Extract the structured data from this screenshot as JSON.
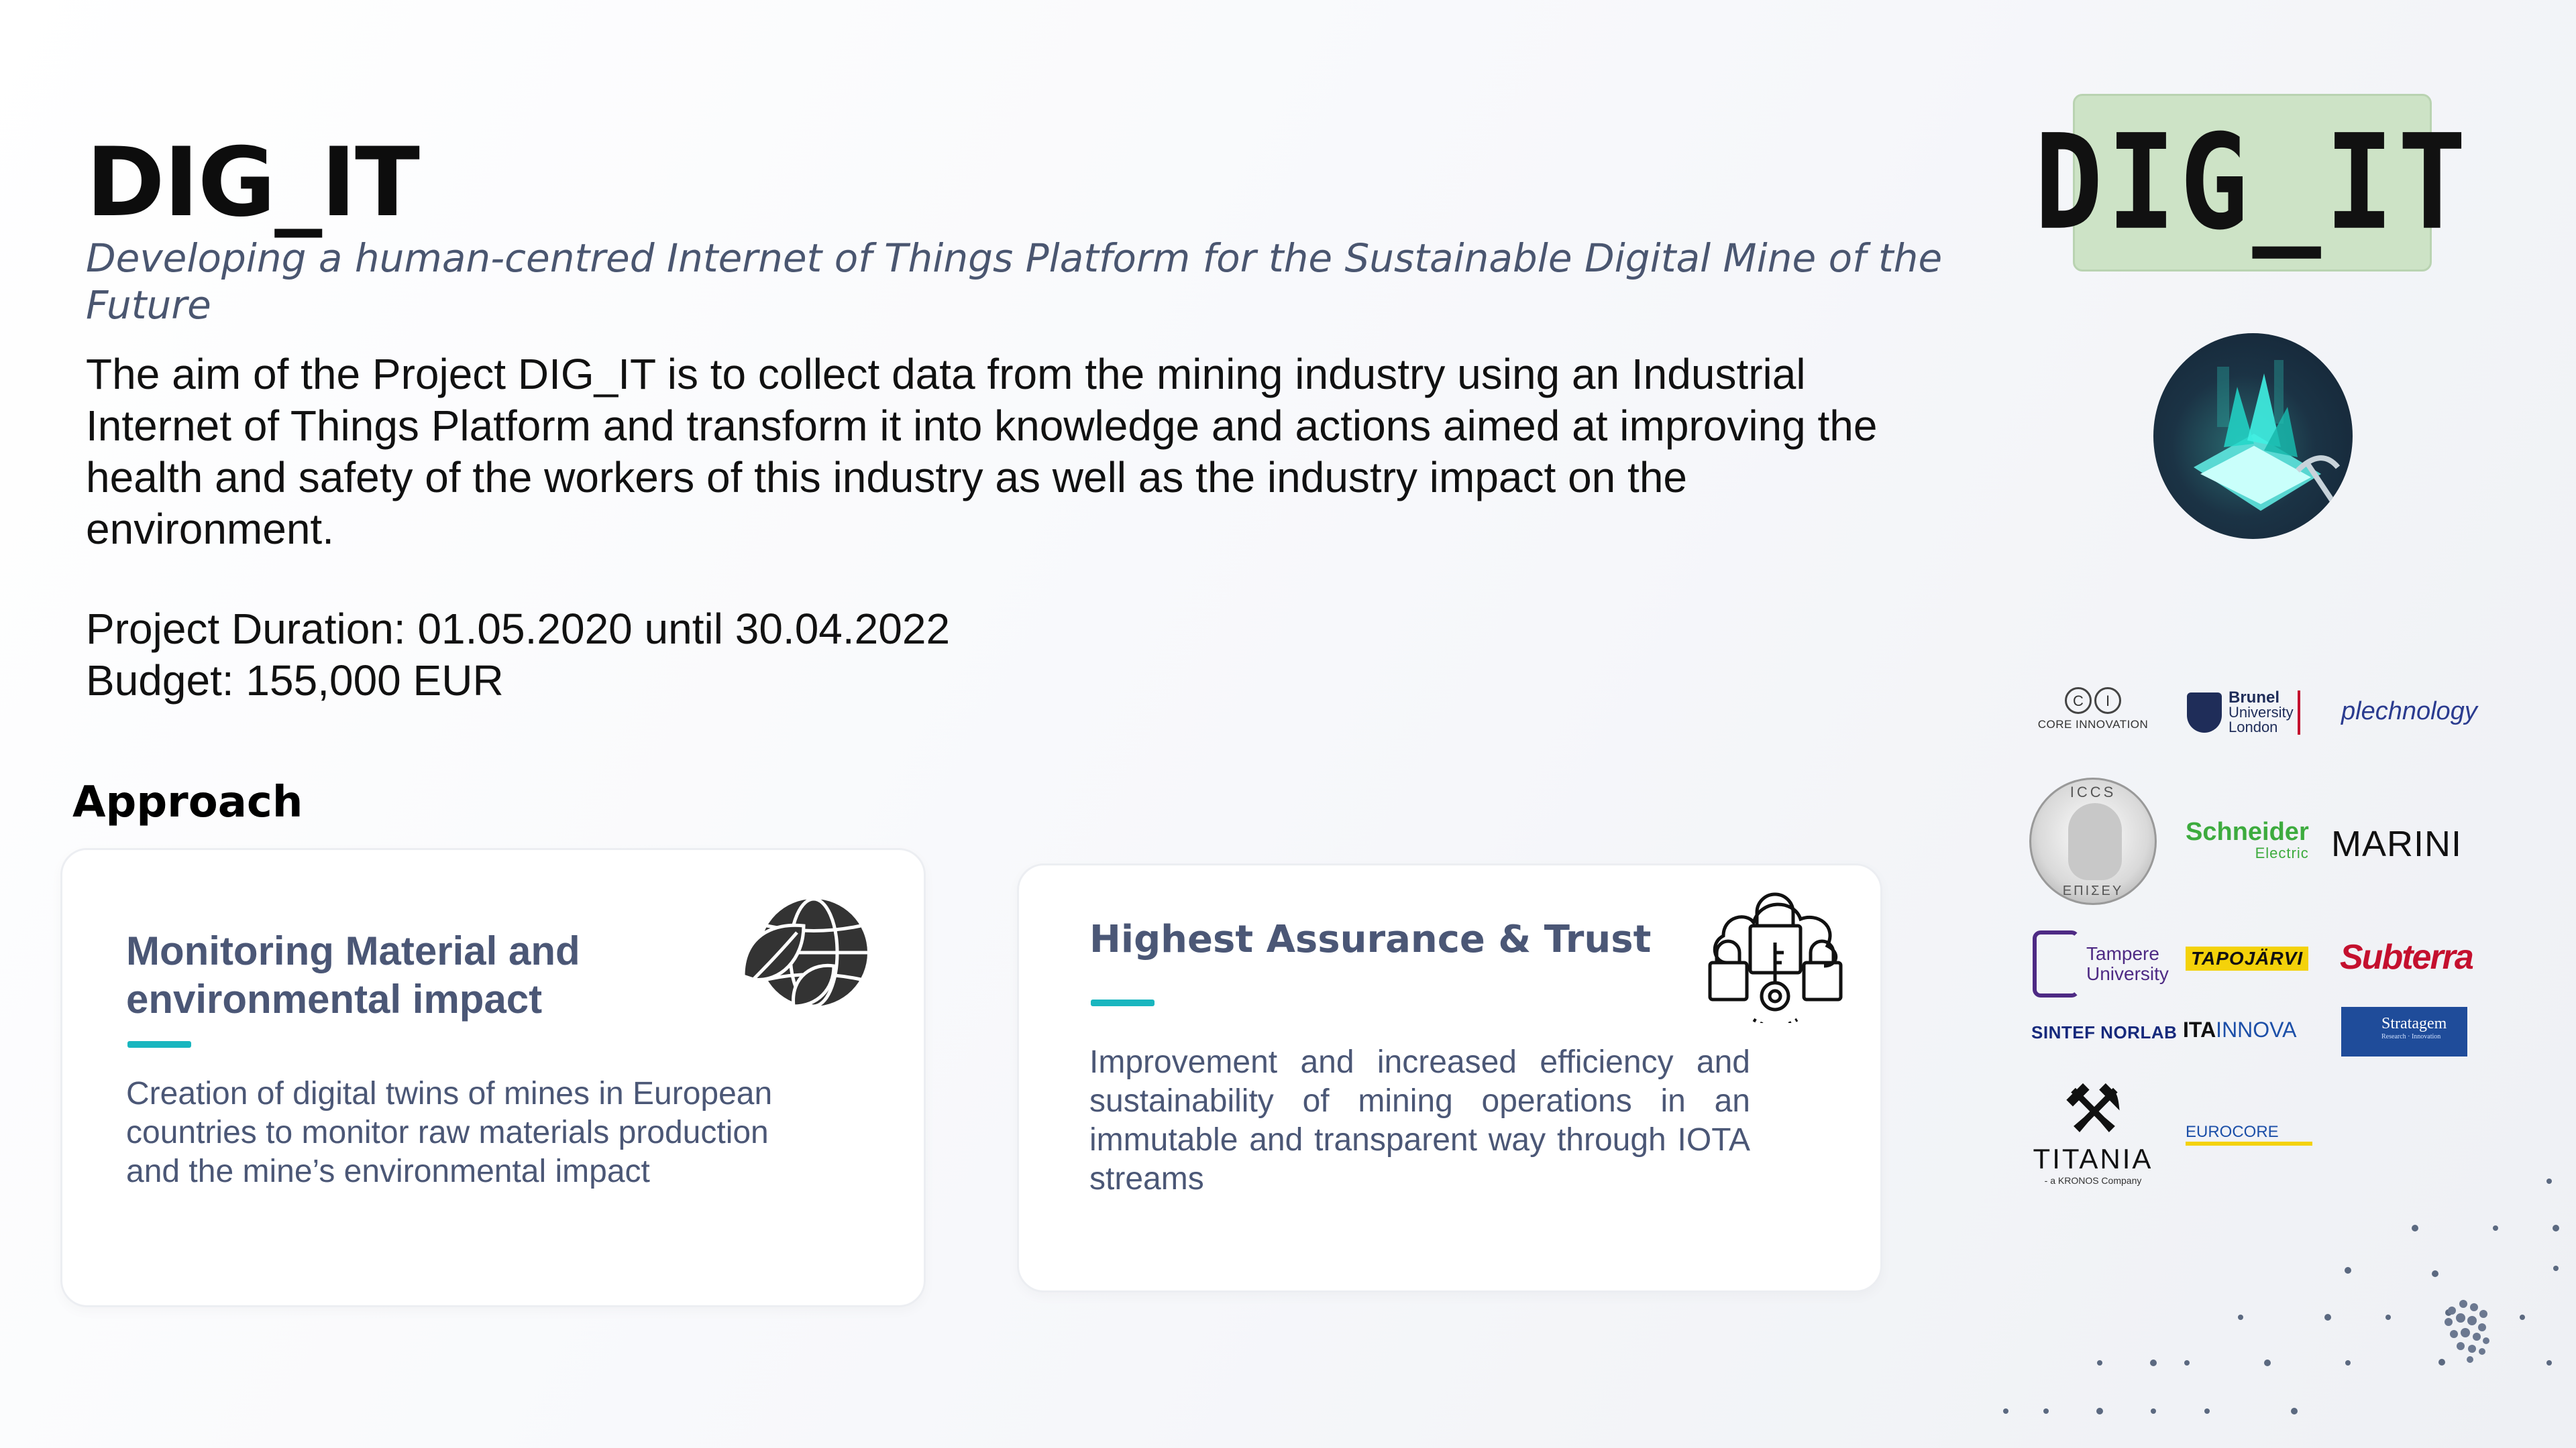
{
  "header": {
    "title": "DIG_IT",
    "subtitle": "Developing a human-centred Internet of Things Platform for the Sustainable Digital Mine of the Future"
  },
  "description": "The aim of the Project DIG_IT is to collect data from the mining industry using an Industrial Internet of Things Platform and transform it into knowledge and actions aimed at improving the health and safety of the workers of this industry as well as the industry impact on the environment.",
  "project": {
    "duration": "Project Duration: 01.05.2020 until 30.04.2022",
    "budget": "Budget: 155,000 EUR"
  },
  "approach": {
    "heading": "Approach",
    "cards": [
      {
        "title": "Monitoring Material and environmental impact",
        "text": "Creation of digital twins of mines in European countries to monitor raw materials production and the mine’s environmental impact",
        "icon": "globe-leaf-icon"
      },
      {
        "title": "Highest Assurance & Trust",
        "text": "Improvement and increased efficiency and sustainability of mining operations in an immutable and transparent way through IOTA streams",
        "icon": "cloud-lock-key-icon"
      }
    ]
  },
  "logo": {
    "text": "DIG_IT"
  },
  "partners": {
    "core": "CORE INNOVATION",
    "core_mark": [
      "C",
      "I"
    ],
    "brunel": [
      "Brunel",
      "University",
      "London"
    ],
    "plechnology": "plechnology",
    "iccs_top": "ICCS",
    "iccs_bottom": "ΕΠΙΣΕΥ",
    "schneider": "Schneider",
    "schneider_sub": "Electric",
    "marini": "MARINI",
    "tampere": [
      "Tampere",
      "University"
    ],
    "tapojarvi": "TAPOJÄRVI",
    "subterra": "Subterra",
    "sintef": "SINTEF NORLAB",
    "ita": "ITA",
    "ita_innova": "INNOVA",
    "stratagem": "Stratagem",
    "stratagem_sub": "Research · Innovation",
    "titania": "TITANIA",
    "titania_sub": "- a KRONOS Company",
    "eurocore": "EUROCORE"
  },
  "colors": {
    "accent": "#19b6bf",
    "card_text": "#4b5776",
    "logo_bg": "#cde3c6"
  }
}
